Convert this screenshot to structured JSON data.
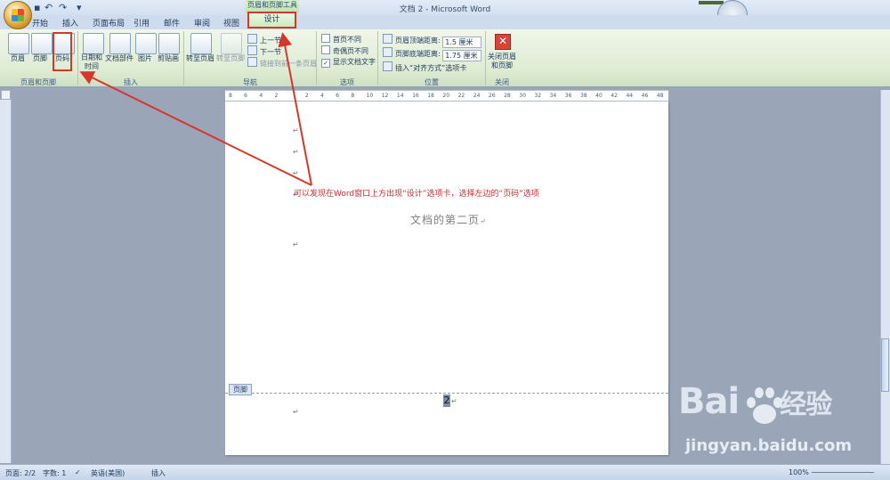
{
  "window": {
    "title": "文档 2 - Microsoft Word",
    "contextual_tool_title": "页眉和页脚工具"
  },
  "tabs": [
    "开始",
    "插入",
    "页面布局",
    "引用",
    "邮件",
    "审阅",
    "视图"
  ],
  "active_tab": "设计",
  "ribbon": {
    "groups": {
      "header_footer": {
        "label": "页眉和页脚",
        "header": "页眉",
        "footer": "页脚",
        "page_number": "页码"
      },
      "insert": {
        "label": "插入",
        "date_time": [
          "日期和",
          "时间"
        ],
        "quick_parts": "文档部件",
        "picture": "图片",
        "clip_art": "剪贴画"
      },
      "navigation": {
        "label": "导航",
        "goto_header": "转至页眉",
        "goto_footer": "转至页脚",
        "previous_section": "上一节",
        "next_section": "下一节",
        "link_to_previous": "链接到前一条页眉"
      },
      "options": {
        "label": "选项",
        "different_first_page": "首页不同",
        "different_odd_even": "奇偶页不同",
        "show_document_text": "显示文档文字",
        "show_document_text_checked": true
      },
      "position": {
        "label": "位置",
        "header_from_top_label": "页眉顶端距离:",
        "header_from_top_value": "1.5 厘米",
        "footer_from_bottom_label": "页脚底端距离:",
        "footer_from_bottom_value": "1.75 厘米",
        "insert_alignment_tab": "插入“对齐方式”选项卡"
      },
      "close": {
        "label": "关闭",
        "close_header_footer": [
          "关闭页眉",
          "和页脚"
        ]
      }
    }
  },
  "ruler": {
    "ticks": [
      "8",
      "6",
      "4",
      "2",
      "",
      "2",
      "4",
      "6",
      "8",
      "10",
      "12",
      "14",
      "16",
      "18",
      "20",
      "22",
      "24",
      "26",
      "28",
      "30",
      "32",
      "34",
      "36",
      "38",
      "40",
      "42",
      "44",
      "46",
      "48"
    ]
  },
  "document": {
    "paragraph_mark": "↵",
    "heading": "文档的第二页",
    "footer_tag": "页脚",
    "page_number": "2"
  },
  "annotation": {
    "text": "可以发现在Word窗口上方出现“设计”选项卡，选择左边的“页码”选项"
  },
  "statusbar": {
    "page": "页面: 2/2",
    "words": "字数: 1",
    "language": "英语(美国)",
    "mode": "插入",
    "zoom": "100%"
  },
  "watermark": {
    "logo": "Bai",
    "logo_cn": "经验",
    "url": "jingyan.baidu.com"
  },
  "colors": {
    "accent_red": "#d9362a",
    "ribbon_green": "#dfecd4"
  }
}
